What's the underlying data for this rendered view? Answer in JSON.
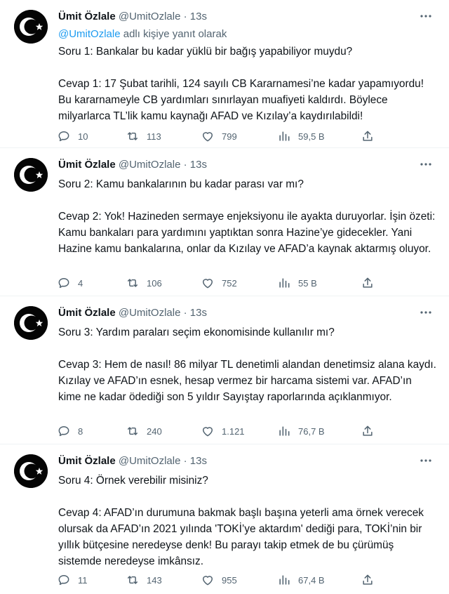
{
  "reply_context": {
    "prefix": "@UmitOzlale",
    "suffix": " adlı kişiye yanıt olarak"
  },
  "tweets": [
    {
      "name": "Ümit Özlale",
      "handle": "@UmitOzlale",
      "dot": "·",
      "time": "13s",
      "text": "Soru 1: Bankalar bu kadar yüklü bir bağış yapabiliyor muydu?\n\nCevap 1: 17 Şubat tarihli, 124 sayılı CB Kararnamesi’ne kadar yapamıyordu! Bu kararnameyle CB yardımları sınırlayan muafiyeti kaldırdı. Böylece milyarlarca TL’lik kamu kaynağı AFAD ve Kızılay’a kaydırılabildi!",
      "replies": "10",
      "retweets": "113",
      "likes": "799",
      "views": "59,5 B"
    },
    {
      "name": "Ümit Özlale",
      "handle": "@UmitOzlale",
      "dot": "·",
      "time": "13s",
      "text": "Soru 2: Kamu bankalarının bu kadar parası var mı?\n\nCevap 2: Yok! Hazineden sermaye enjeksiyonu ile ayakta duruyorlar. İşin özeti: Kamu bankaları para yardımını yaptıktan sonra Hazine’ye gidecekler. Yani Hazine kamu bankalarına, onlar da Kızılay ve AFAD’a kaynak aktarmış oluyor.",
      "replies": "4",
      "retweets": "106",
      "likes": "752",
      "views": "55 B"
    },
    {
      "name": "Ümit Özlale",
      "handle": "@UmitOzlale",
      "dot": "·",
      "time": "13s",
      "text": "Soru 3: Yardım paraları seçim ekonomisinde kullanılır mı?\n\nCevap 3: Hem de nasıl! 86 milyar TL denetimli alandan denetimsiz alana kaydı. Kızılay ve AFAD’ın esnek, hesap vermez bir harcama sistemi var. AFAD’ın kime ne kadar ödediği son 5 yıldır Sayıştay raporlarında açıklanmıyor.",
      "replies": "8",
      "retweets": "240",
      "likes": "1.121",
      "views": "76,7 B"
    },
    {
      "name": "Ümit Özlale",
      "handle": "@UmitOzlale",
      "dot": "·",
      "time": "13s",
      "text": "Soru 4: Örnek verebilir misiniz?\n\nCevap 4: AFAD’ın durumuna bakmak başlı başına yeterli ama örnek verecek olursak da AFAD’ın 2021 yılında 'TOKİ’ye aktardım' dediği para, TOKİ’nin bir yıllık bütçesine neredeyse denk! Bu parayı takip etmek de bu çürümüş sistemde neredeyse imkânsız.",
      "replies": "11",
      "retweets": "143",
      "likes": "955",
      "views": "67,4 B"
    }
  ]
}
